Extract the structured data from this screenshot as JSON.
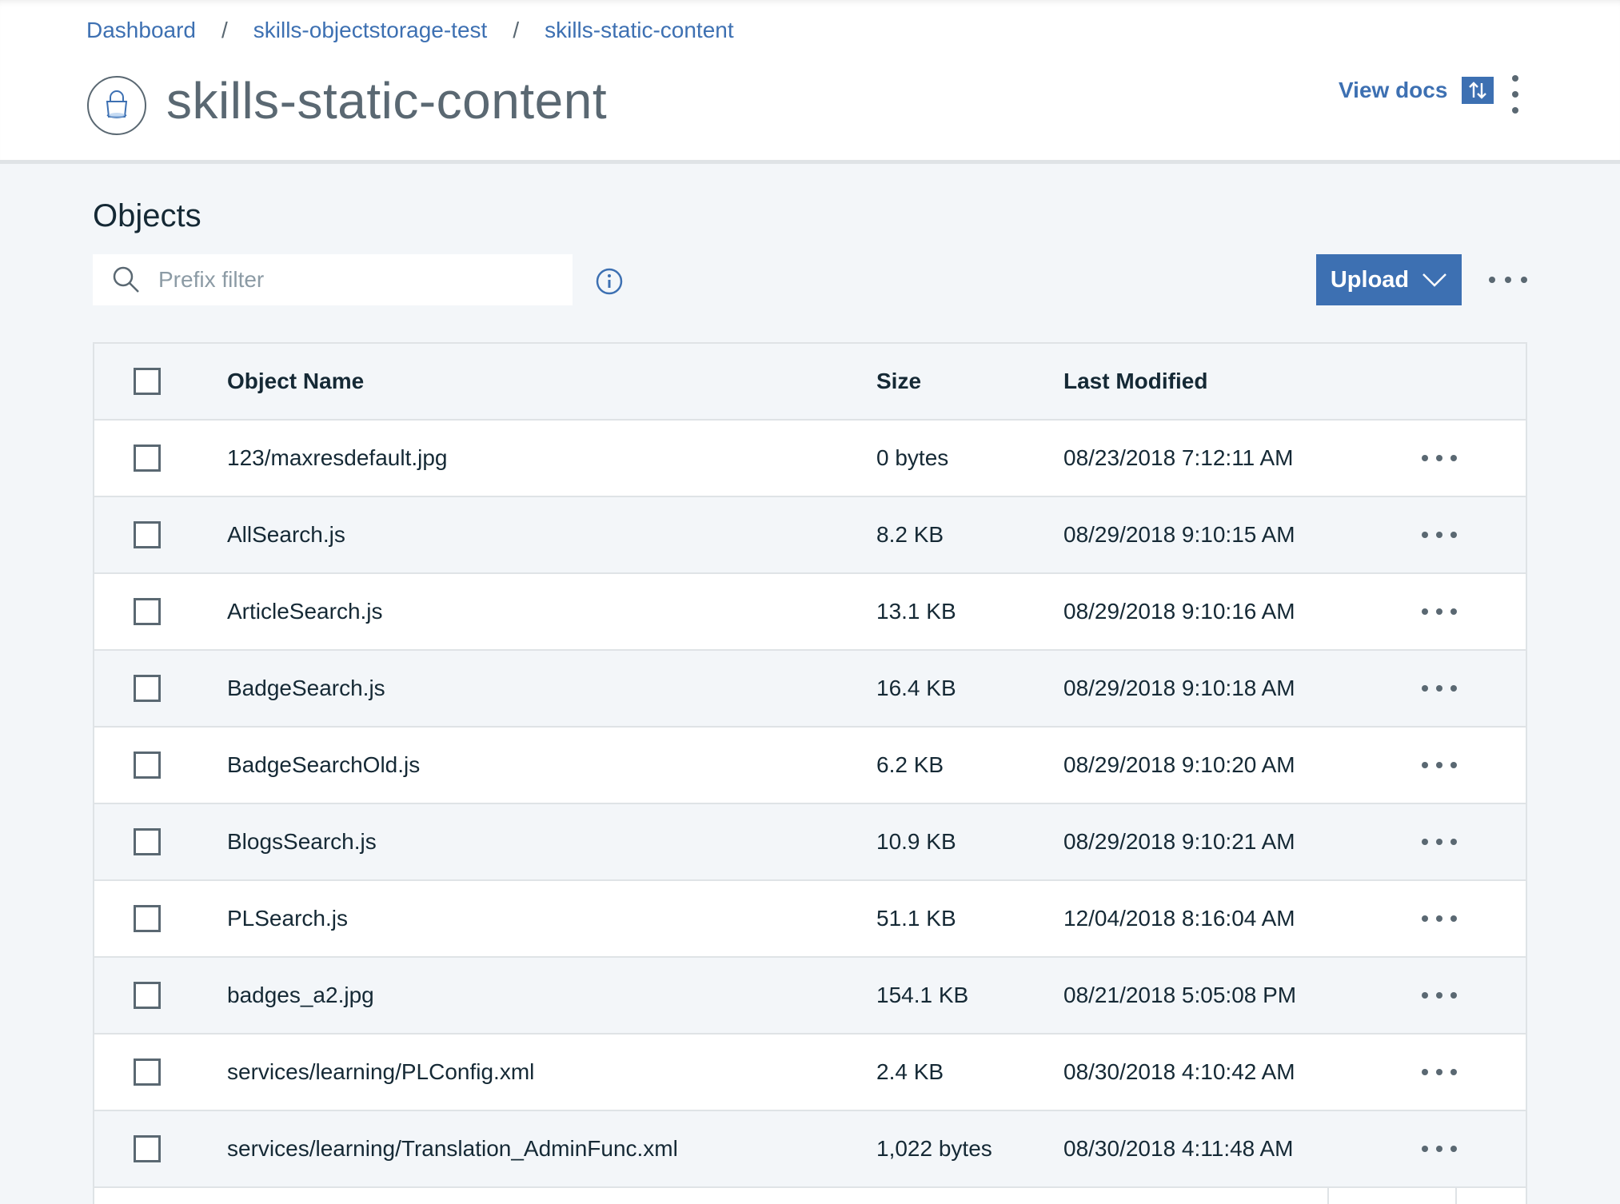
{
  "breadcrumb": {
    "items": [
      "Dashboard",
      "skills-objectstorage-test",
      "skills-static-content"
    ],
    "separator": "/"
  },
  "header": {
    "title": "skills-static-content",
    "bucket_icon": "bucket-lock-icon",
    "view_docs_label": "View docs",
    "view_docs_icon": "swap-vertical-icon",
    "overflow_icon": "kebab-vertical-icon"
  },
  "objects": {
    "title": "Objects",
    "search": {
      "placeholder": "Prefix filter",
      "value": "",
      "icon": "search-icon"
    },
    "info_icon": "info-icon",
    "upload_label": "Upload",
    "upload_icon": "chevron-down-icon",
    "overflow_icon": "overflow-horizontal-icon"
  },
  "table": {
    "columns": {
      "name": "Object Name",
      "size": "Size",
      "modified": "Last Modified"
    },
    "rows": [
      {
        "name": "123/maxresdefault.jpg",
        "size": "0 bytes",
        "modified": "08/23/2018 7:12:11 AM"
      },
      {
        "name": "AllSearch.js",
        "size": "8.2 KB",
        "modified": "08/29/2018 9:10:15 AM"
      },
      {
        "name": "ArticleSearch.js",
        "size": "13.1 KB",
        "modified": "08/29/2018 9:10:16 AM"
      },
      {
        "name": "BadgeSearch.js",
        "size": "16.4 KB",
        "modified": "08/29/2018 9:10:18 AM"
      },
      {
        "name": "BadgeSearchOld.js",
        "size": "6.2 KB",
        "modified": "08/29/2018 9:10:20 AM"
      },
      {
        "name": "BlogsSearch.js",
        "size": "10.9 KB",
        "modified": "08/29/2018 9:10:21 AM"
      },
      {
        "name": "PLSearch.js",
        "size": "51.1 KB",
        "modified": "12/04/2018 8:16:04 AM"
      },
      {
        "name": "badges_a2.jpg",
        "size": "154.1 KB",
        "modified": "08/21/2018 5:05:08 PM"
      },
      {
        "name": "services/learning/PLConfig.xml",
        "size": "2.4 KB",
        "modified": "08/30/2018 4:10:42 AM"
      },
      {
        "name": "services/learning/Translation_AdminFunc.xml",
        "size": "1,022 bytes",
        "modified": "08/30/2018 4:11:48 AM"
      }
    ]
  },
  "colors": {
    "accent": "#3d70b2",
    "text": "#152935",
    "muted": "#5a6872",
    "page_bg": "#f3f6f9",
    "border": "#dfe3e6"
  }
}
